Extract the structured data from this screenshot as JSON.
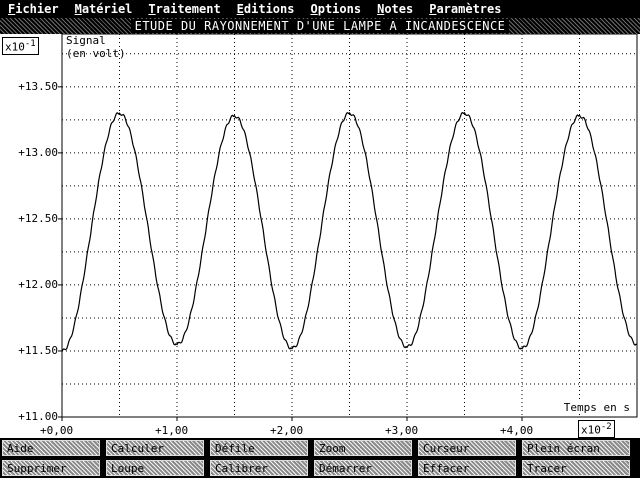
{
  "menu": [
    {
      "first": "F",
      "rest": "ichier"
    },
    {
      "first": "M",
      "rest": "atériel"
    },
    {
      "first": "T",
      "rest": "raitement"
    },
    {
      "first": "E",
      "rest": "ditions"
    },
    {
      "first": "O",
      "rest": "ptions"
    },
    {
      "first": "N",
      "rest": "otes"
    },
    {
      "first": "P",
      "rest": "aramètres"
    }
  ],
  "window_title": "ETUDE DU RAYONNEMENT D'UNE LAMPE A INCANDESCENCE",
  "y_unit_base": "x10",
  "y_unit_exp": "-1",
  "x_unit_base": "x10",
  "x_unit_exp": "-2",
  "chart_data": {
    "type": "line",
    "ylabel": "Signal\n(en volt)",
    "xlabel": "Temps en s",
    "xlim": [
      0,
      5
    ],
    "ylim": [
      11.0,
      13.9
    ],
    "x_ticks": [
      "+0,00",
      "+1,00",
      "+2,00",
      "+3,00",
      "+4,00"
    ],
    "y_ticks": [
      "+13.50",
      "+13.00",
      "+12.50",
      "+12.00",
      "+11.50",
      "+11.00"
    ],
    "grid": true,
    "series": [
      {
        "x": [
          0.0,
          0.5,
          1.0,
          1.5,
          2.0,
          2.5,
          3.0,
          3.5,
          4.0,
          4.5,
          5.0
        ],
        "y": [
          11.5,
          13.3,
          11.55,
          13.28,
          11.52,
          13.3,
          11.53,
          13.3,
          11.52,
          13.28,
          11.55
        ]
      }
    ]
  },
  "buttons_row1": [
    "Aide",
    "Calculer",
    "Défile",
    "Zoom",
    "Curseur",
    "Plein écran"
  ],
  "buttons_row2": [
    "Supprimer",
    "Loupe",
    "Calibrer",
    "Démarrer",
    "Effacer",
    "Tracer"
  ]
}
